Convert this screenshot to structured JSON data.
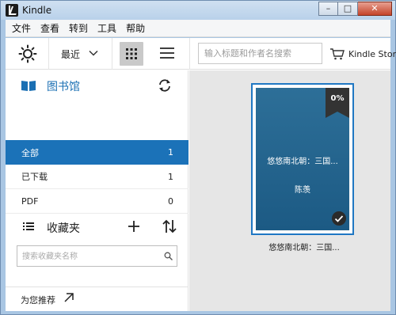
{
  "window": {
    "title": "Kindle",
    "minimize": "–",
    "maximize": "□",
    "close": "✕"
  },
  "menu": [
    "文件",
    "查看",
    "转到",
    "工具",
    "帮助"
  ],
  "toolbar": {
    "brightness_icon": "sun-icon",
    "sort_label": "最近",
    "search_placeholder": "输入标题和作者名搜索",
    "store_label": "Kindle Store"
  },
  "sidebar": {
    "library_title": "图书馆",
    "filters": [
      {
        "label": "全部",
        "count": "1",
        "active": true
      },
      {
        "label": "已下载",
        "count": "1",
        "active": false
      },
      {
        "label": "PDF",
        "count": "0",
        "active": false
      }
    ],
    "collections_title": "收藏夹",
    "collection_search_placeholder": "搜索收藏夹名称",
    "recommend_label": "为您推荐"
  },
  "library": {
    "books": [
      {
        "progress": "0%",
        "cover_title": "悠悠南北朝：三国...",
        "cover_author": "陈羡",
        "caption": "悠悠南北朝：三国...",
        "downloaded": true
      }
    ]
  },
  "colors": {
    "accent": "#1b72b8",
    "cover": "#23648e",
    "library_bg": "#e6e6e6"
  }
}
